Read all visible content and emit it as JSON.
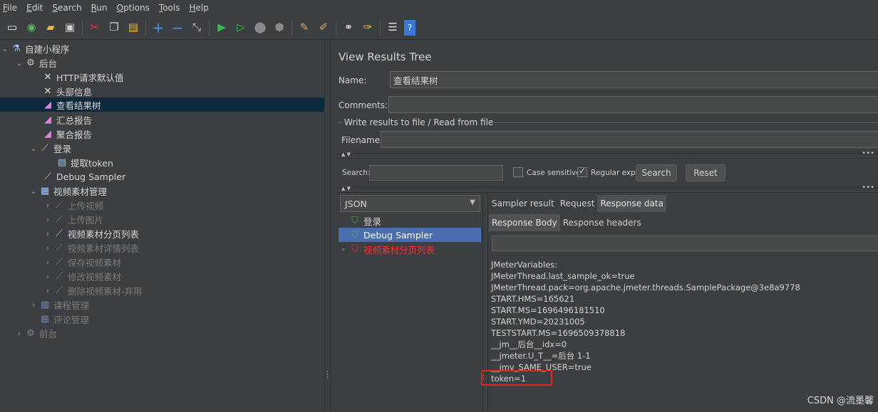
{
  "menu": [
    "File",
    "Edit",
    "Search",
    "Run",
    "Options",
    "Tools",
    "Help"
  ],
  "toolbar_icons": [
    "new-icon",
    "templates-icon",
    "open-icon",
    "save-icon",
    "cut-icon",
    "copy-icon",
    "paste-icon",
    "expand-icon",
    "collapse-icon",
    "toggle-icon",
    "start-icon",
    "start-no-pause-icon",
    "stop-icon",
    "shutdown-icon",
    "clear-icon",
    "clear-all-icon",
    "search-icon",
    "reset-search-icon",
    "function-helper-icon",
    "help-icon"
  ],
  "tree": {
    "items": [
      {
        "label": "自建小程序",
        "icon": "test-plan-icon",
        "disabled": false
      },
      {
        "label": "后台",
        "icon": "thread-group-icon",
        "disabled": false
      },
      {
        "label": "HTTP请求默认值",
        "icon": "config-tools-icon",
        "disabled": false
      },
      {
        "label": "头部信息",
        "icon": "config-tools-icon",
        "disabled": false
      },
      {
        "label": "查看结果树",
        "icon": "listener-icon",
        "disabled": false
      },
      {
        "label": "汇总报告",
        "icon": "listener-icon",
        "disabled": false
      },
      {
        "label": "聚合报告",
        "icon": "listener-icon",
        "disabled": false
      },
      {
        "label": "登录",
        "icon": "sampler-icon",
        "disabled": false
      },
      {
        "label": "提取token",
        "icon": "post-processor-icon",
        "disabled": false
      },
      {
        "label": "Debug Sampler",
        "icon": "sampler-icon",
        "disabled": false
      },
      {
        "label": "视频素材管理",
        "icon": "controller-icon",
        "disabled": false
      },
      {
        "label": "上传视频",
        "icon": "sampler-icon",
        "disabled": true
      },
      {
        "label": "上传图片",
        "icon": "sampler-icon",
        "disabled": true
      },
      {
        "label": "视频素材分页列表",
        "icon": "sampler-icon",
        "disabled": false
      },
      {
        "label": "视频素材详情列表",
        "icon": "sampler-icon",
        "disabled": true
      },
      {
        "label": "保存视频素材",
        "icon": "sampler-icon",
        "disabled": true
      },
      {
        "label": "修改视频素材",
        "icon": "sampler-icon",
        "disabled": true
      },
      {
        "label": "删除视频素材-弃用",
        "icon": "sampler-icon",
        "disabled": true
      },
      {
        "label": "课程管理",
        "icon": "controller-icon",
        "disabled": true
      },
      {
        "label": "评论管理",
        "icon": "controller-icon",
        "disabled": true
      },
      {
        "label": "前台",
        "icon": "thread-group-icon",
        "disabled": true
      }
    ]
  },
  "panel": {
    "title": "View Results Tree",
    "name_label": "Name:",
    "name_value": "查看结果树",
    "comments_label": "Comments:",
    "comments_value": "",
    "file_group": "Write results to file / Read from file",
    "filename_label": "Filename",
    "filename_value": "",
    "search_label": "Search:",
    "search_value": "",
    "case_sensitive": "Case sensitive",
    "case_sensitive_checked": false,
    "regular_exp": "Regular exp.",
    "regular_exp_checked": true,
    "search_button": "Search",
    "reset_button": "Reset"
  },
  "results": {
    "renderer": "JSON",
    "items": [
      {
        "label": "登录",
        "status": "success",
        "selected": false
      },
      {
        "label": "Debug Sampler",
        "status": "success",
        "selected": true
      },
      {
        "label": "视频素材分页列表",
        "status": "error",
        "selected": false
      }
    ],
    "tabs": [
      "Sampler result",
      "Request",
      "Response data"
    ],
    "active_tab": "Response data",
    "subtabs": [
      "Response Body",
      "Response headers"
    ],
    "active_subtab": "Response Body",
    "variables": [
      "JMeterVariables:",
      "JMeterThread.last_sample_ok=true",
      "JMeterThread.pack=org.apache.jmeter.threads.SamplePackage@3e8a9778",
      "START.HMS=165621",
      "START.MS=1696496181510",
      "START.YMD=20231005",
      "TESTSTART.MS=1696509378818",
      "__jm__后台__idx=0",
      "__jmeter.U_T__=后台 1-1",
      "__jmv_SAME_USER=true",
      "token=1"
    ]
  },
  "watermark": "CSDN @流墨馨",
  "colors": {
    "selection": "#0d293e",
    "result_selection": "#4b6eaf",
    "error": "#ff2b2b",
    "highlight_box": "#e8221c"
  }
}
